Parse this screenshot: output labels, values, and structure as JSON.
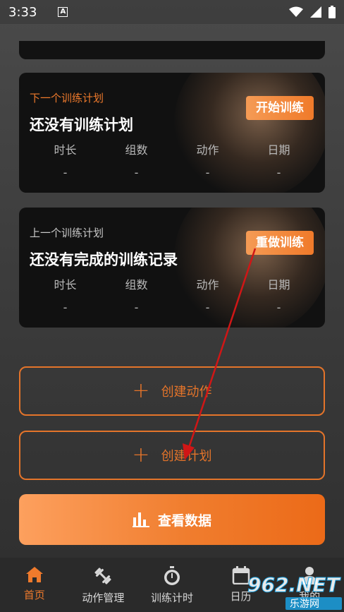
{
  "status_bar": {
    "time": "3:33"
  },
  "next_plan": {
    "eyebrow": "下一个训练计划",
    "title": "还没有训练计划",
    "action_label": "开始训练",
    "stats": [
      {
        "label": "时长",
        "value": "-"
      },
      {
        "label": "组数",
        "value": "-"
      },
      {
        "label": "动作",
        "value": "-"
      },
      {
        "label": "日期",
        "value": "-"
      }
    ]
  },
  "previous_plan": {
    "eyebrow": "上一个训练计划",
    "title": "还没有完成的训练记录",
    "action_label": "重做训练",
    "stats": [
      {
        "label": "时长",
        "value": "-"
      },
      {
        "label": "组数",
        "value": "-"
      },
      {
        "label": "动作",
        "value": "-"
      },
      {
        "label": "日期",
        "value": "-"
      }
    ]
  },
  "buttons": {
    "create_action": "创建动作",
    "create_plan": "创建计划",
    "view_data": "查看数据"
  },
  "tabbar": [
    {
      "label": "首页",
      "icon": "home-icon",
      "active": true
    },
    {
      "label": "动作管理",
      "icon": "dumbbell-icon",
      "active": false
    },
    {
      "label": "训练计时",
      "icon": "stopwatch-icon",
      "active": false
    },
    {
      "label": "日历",
      "icon": "calendar-icon",
      "active": false
    },
    {
      "label": "我的",
      "icon": "person-icon",
      "active": false
    }
  ],
  "watermark": {
    "text": "962.NET",
    "subtext": "乐游网"
  },
  "colors": {
    "accent": "#ef7a2c",
    "card": "#111111",
    "annotation_arrow": "#d01616"
  }
}
